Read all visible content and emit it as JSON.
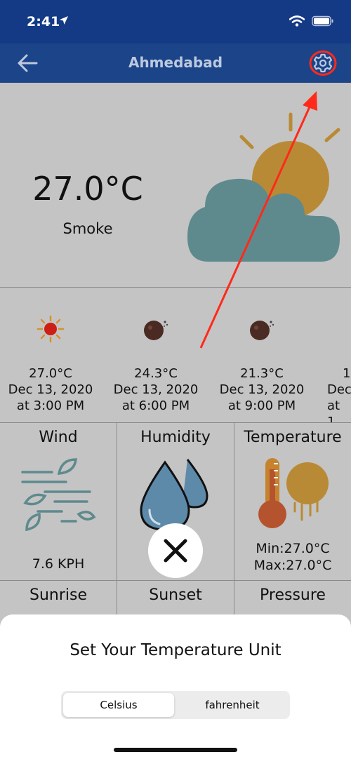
{
  "status_bar": {
    "time": "2:41"
  },
  "nav": {
    "title": "Ahmedabad"
  },
  "current": {
    "temperature": "27.0°C",
    "description": "Smoke"
  },
  "hourly": [
    {
      "icon": "sun-icon",
      "temp": "27.0°C",
      "date": "Dec 13, 2020",
      "time": "at 3:00 PM"
    },
    {
      "icon": "night-haze-icon",
      "temp": "24.3°C",
      "date": "Dec 13, 2020",
      "time": "at 6:00 PM"
    },
    {
      "icon": "night-haze-icon",
      "temp": "21.3°C",
      "date": "Dec 13, 2020",
      "time": "at 9:00 PM"
    },
    {
      "icon": "night-haze-icon",
      "temp": "1",
      "date": "Dec",
      "time": "at 1"
    }
  ],
  "details": {
    "wind": {
      "title": "Wind",
      "value": "7.6 KPH"
    },
    "humidity": {
      "title": "Humidity"
    },
    "temperature": {
      "title": "Temperature",
      "min": "Min:27.0°C",
      "max": "Max:27.0°C"
    },
    "sunrise": {
      "title": "Sunrise"
    },
    "sunset": {
      "title": "Sunset"
    },
    "pressure": {
      "title": "Pressure"
    }
  },
  "unit_sheet": {
    "title": "Set Your Temperature Unit",
    "options": [
      "Celsius",
      "fahrenheit"
    ],
    "selected": "Celsius"
  },
  "colors": {
    "nav_bar": "#1c4489",
    "status_bar": "#143a86",
    "overlay_bg": "#c4c4c4",
    "annotation": "#ff2a1a",
    "sun": "#b98a35",
    "cloud": "#5e8a8e",
    "drop": "#5e8aaa"
  }
}
